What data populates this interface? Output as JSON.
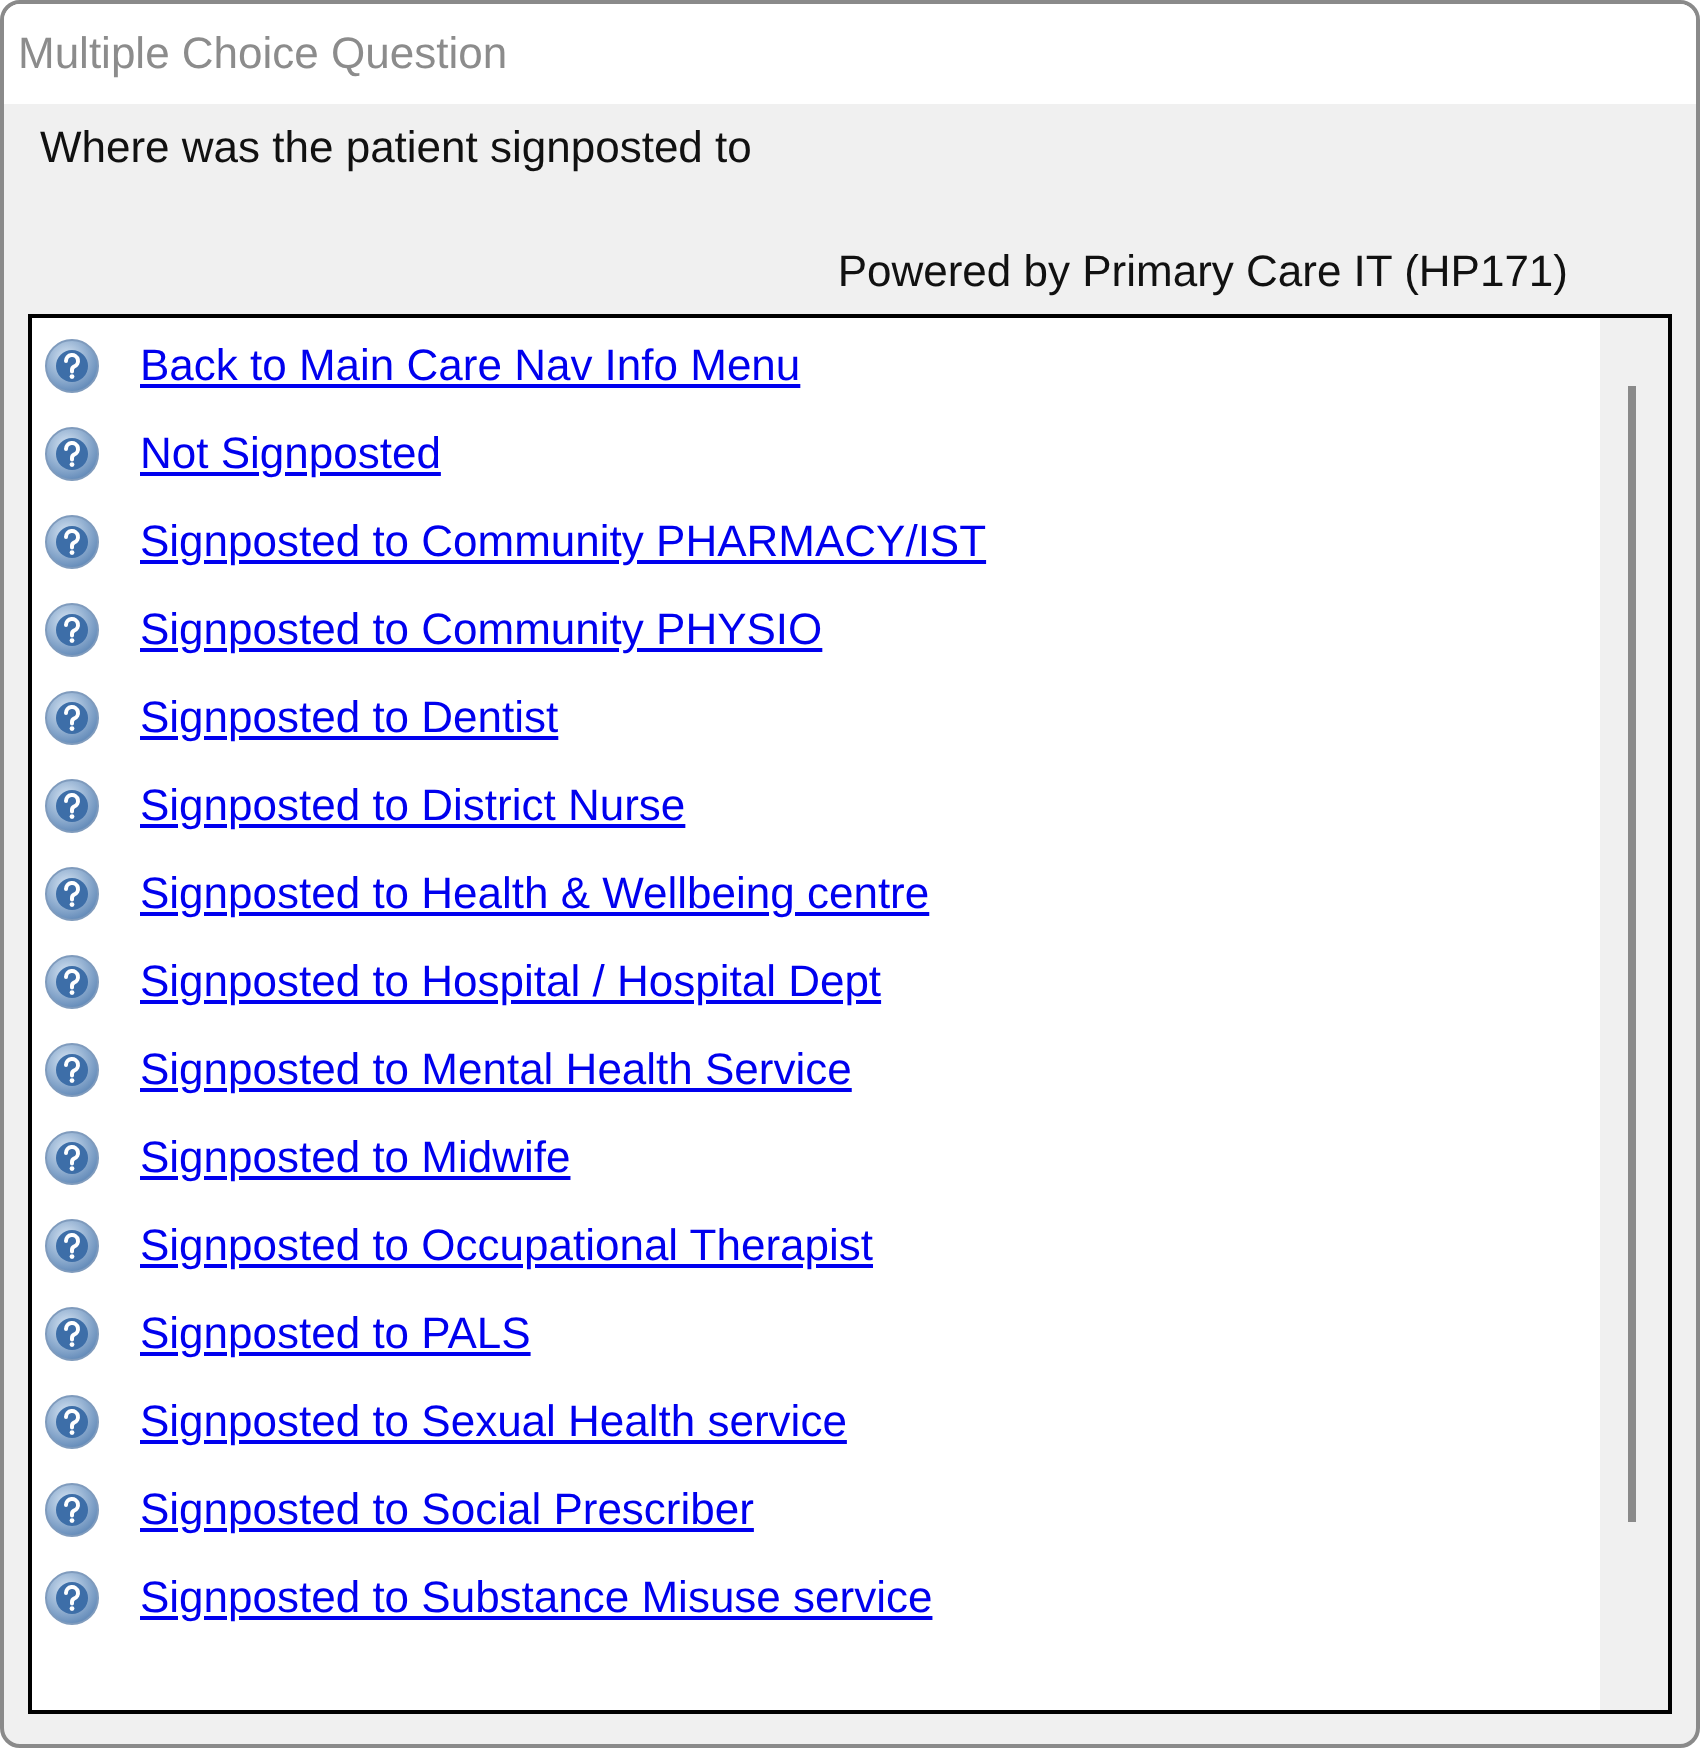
{
  "window": {
    "title": "Multiple Choice Question"
  },
  "question": "Where was the patient signposted to",
  "credit": "Powered by Primary Care IT (HP171)",
  "options": [
    {
      "label": "Back to Main Care Nav Info Menu"
    },
    {
      "label": "Not Signposted"
    },
    {
      "label": "Signposted to Community PHARMACY/IST"
    },
    {
      "label": "Signposted to Community PHYSIO"
    },
    {
      "label": "Signposted to Dentist"
    },
    {
      "label": "Signposted to District Nurse"
    },
    {
      "label": "Signposted to Health & Wellbeing centre"
    },
    {
      "label": "Signposted to Hospital / Hospital Dept"
    },
    {
      "label": "Signposted to Mental Health Service"
    },
    {
      "label": "Signposted to Midwife"
    },
    {
      "label": "Signposted to Occupational Therapist"
    },
    {
      "label": "Signposted to PALS"
    },
    {
      "label": "Signposted to Sexual Health service"
    },
    {
      "label": "Signposted to Social Prescriber"
    },
    {
      "label": "Signposted to Substance Misuse service"
    }
  ]
}
